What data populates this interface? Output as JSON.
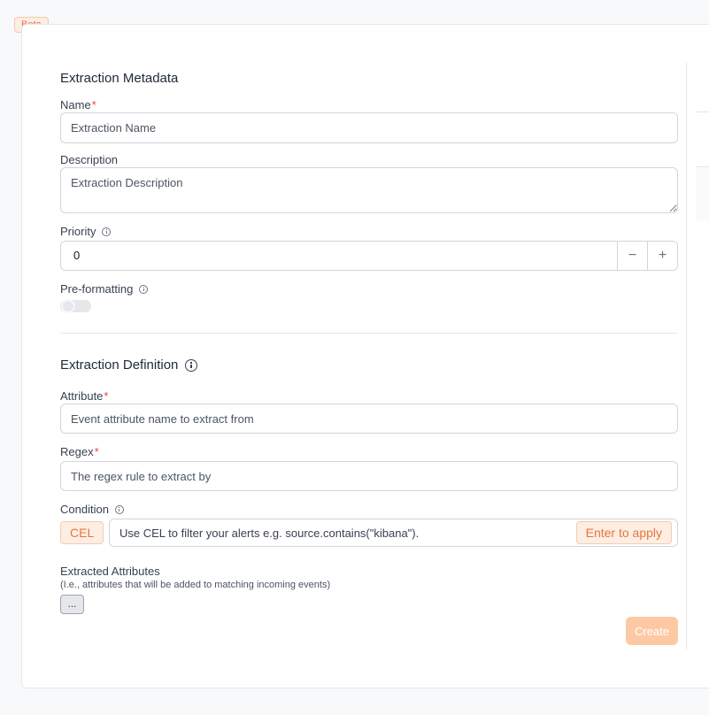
{
  "badge": {
    "beta": "Beta"
  },
  "metadata": {
    "title": "Extraction Metadata",
    "name_label": "Name",
    "name_placeholder": "Extraction Name",
    "description_label": "Description",
    "description_placeholder": "Extraction Description",
    "priority_label": "Priority",
    "priority_value": "0",
    "decrement_symbol": "−",
    "increment_symbol": "+",
    "preformatting_label": "Pre-formatting",
    "preformatting_enabled": false
  },
  "definition": {
    "title": "Extraction Definition",
    "attribute_label": "Attribute",
    "attribute_placeholder": "Event attribute name to extract from",
    "regex_label": "Regex",
    "regex_placeholder": "The regex rule to extract by",
    "condition_label": "Condition",
    "cel_badge": "CEL",
    "condition_placeholder": "Use CEL to filter your alerts e.g. source.contains(\"kibana\").",
    "enter_badge": "Enter to apply",
    "extracted_label": "Extracted Attributes",
    "extracted_sublabel": "(I.e., attributes that will be added to matching incoming events)",
    "dots_button": "..."
  },
  "required_mark": "*",
  "actions": {
    "create_label": "Create"
  },
  "colors": {
    "accent": "#e8753d",
    "accent_bg": "#fdeee4",
    "create_disabled": "#fdc9a4",
    "required": "#ef4444"
  },
  "icons": {
    "info": "info-icon",
    "minus": "minus-icon",
    "plus": "plus-icon"
  }
}
